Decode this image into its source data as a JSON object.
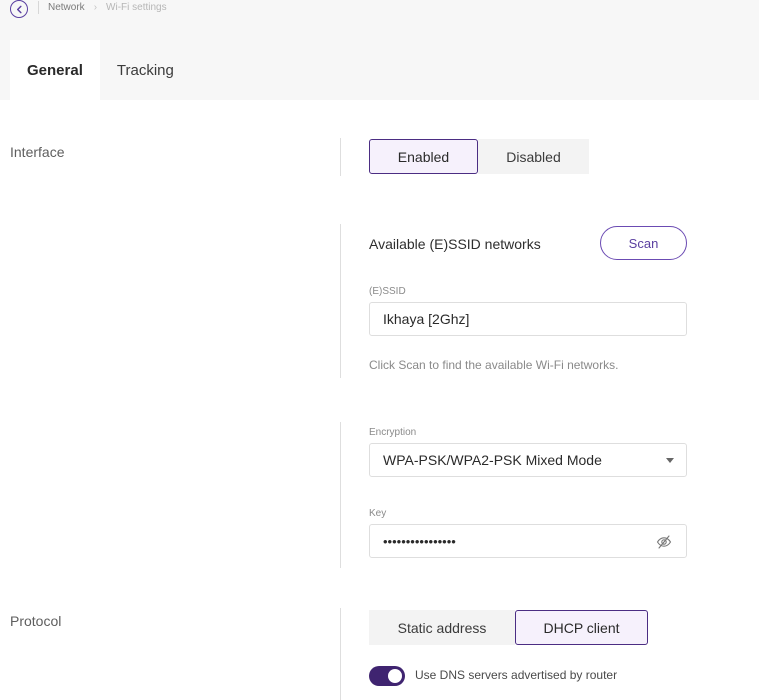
{
  "breadcrumb": {
    "back_icon": "chevron-left-icon",
    "items": [
      "Network",
      "Wi-Fi settings"
    ]
  },
  "tabs": [
    {
      "label": "General",
      "active": true
    },
    {
      "label": "Tracking",
      "active": false
    }
  ],
  "interface": {
    "label": "Interface",
    "options": [
      "Enabled",
      "Disabled"
    ],
    "selected": "Enabled"
  },
  "essid": {
    "section_title": "Available (E)SSID networks",
    "scan_label": "Scan",
    "field_label": "(E)SSID",
    "value": "Ikhaya [2Ghz]",
    "helper": "Click Scan to find the available Wi-Fi networks."
  },
  "encryption": {
    "field_label": "Encryption",
    "value": "WPA-PSK/WPA2-PSK Mixed Mode"
  },
  "key": {
    "field_label": "Key",
    "value": "••••••••••••••••",
    "visibility_icon": "eye-off-icon"
  },
  "protocol": {
    "label": "Protocol",
    "options": [
      "Static address",
      "DHCP client"
    ],
    "selected": "DHCP client",
    "dns_toggle_label": "Use DNS servers advertised by router",
    "dns_toggle_on": true
  },
  "colors": {
    "accent": "#4b2d83",
    "accent_light": "#f6f1fc",
    "toggle_on": "#3f2470"
  }
}
